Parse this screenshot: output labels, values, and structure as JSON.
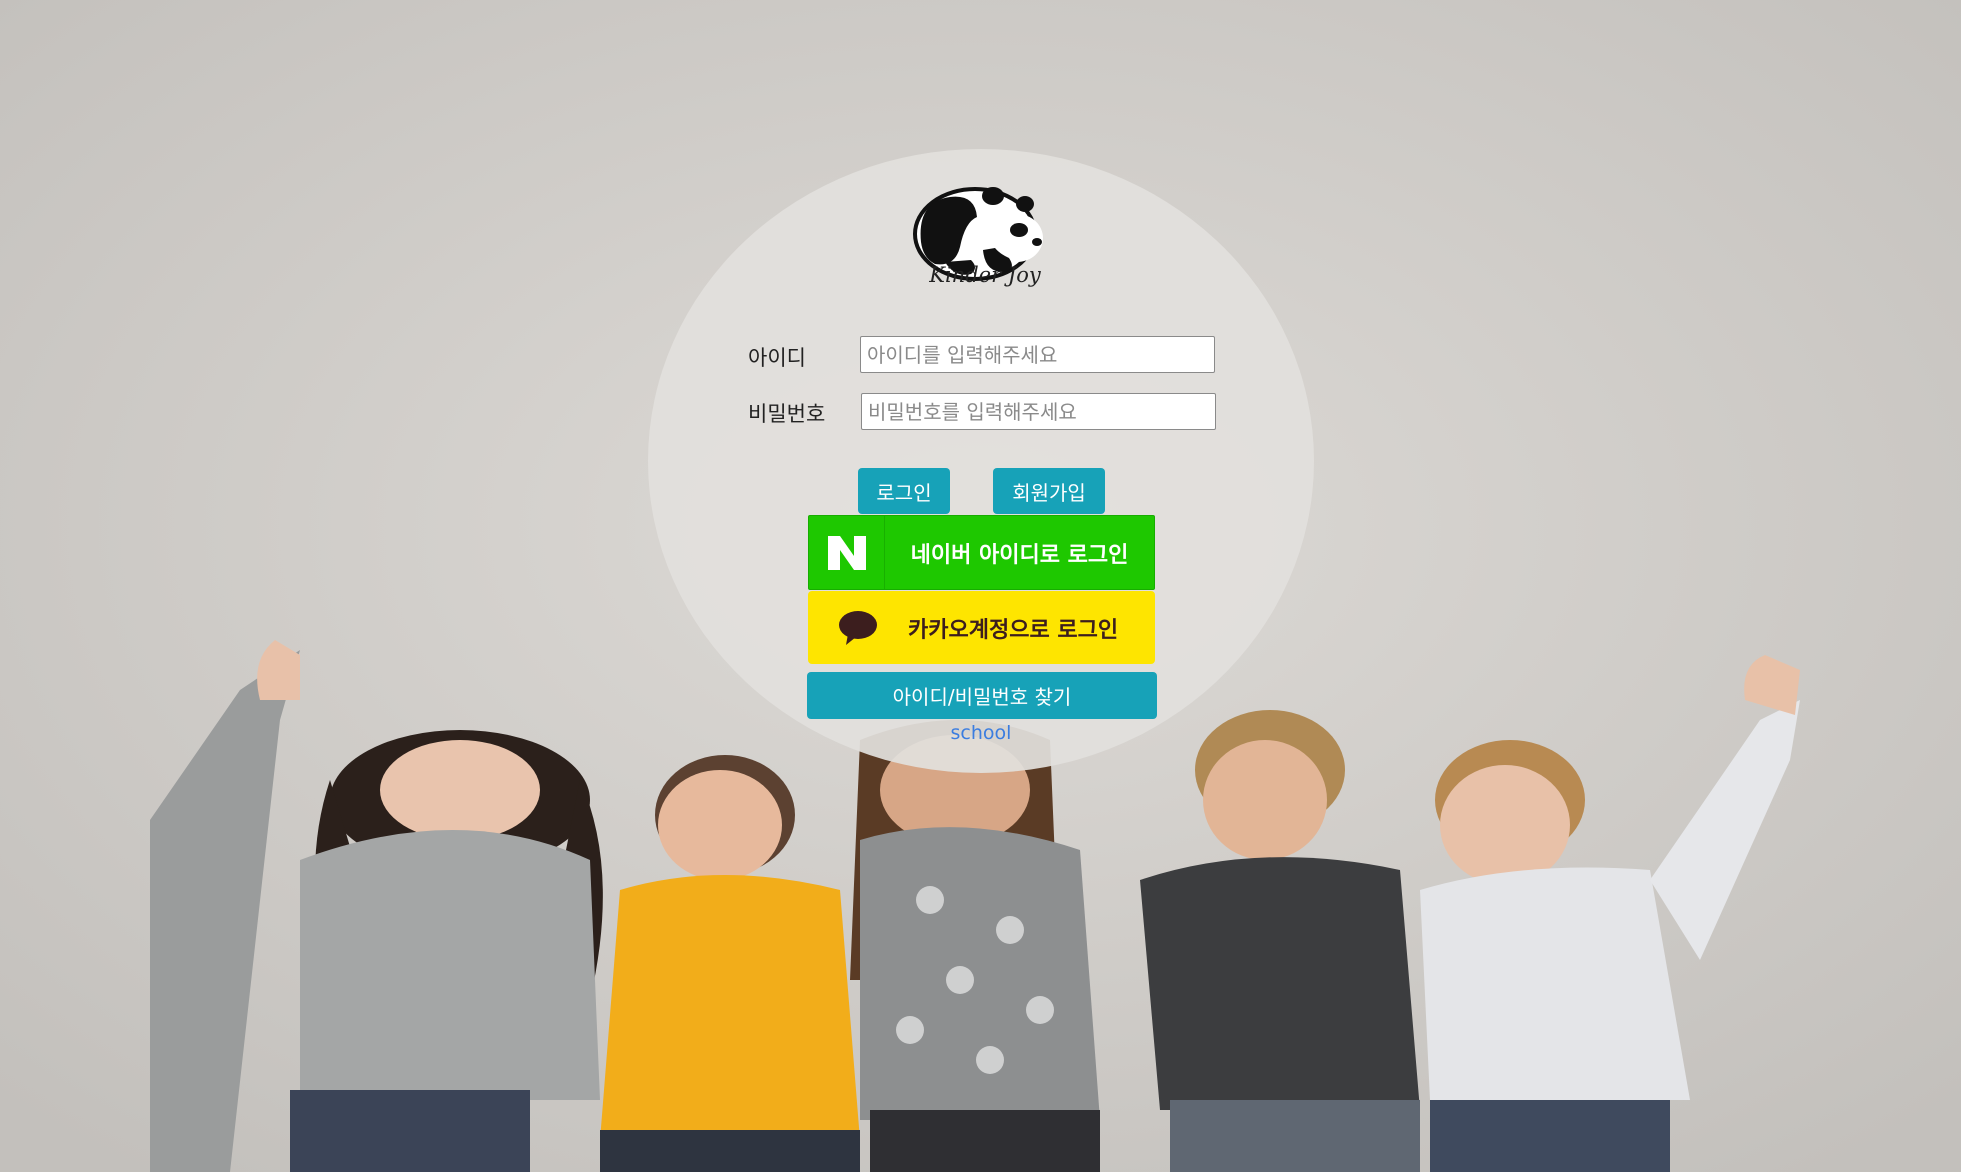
{
  "logo": {
    "icon": "panda-icon",
    "text": "Kinder Joy"
  },
  "form": {
    "id_label": "아이디",
    "id_placeholder": "아이디를 입력해주세요",
    "id_value": "",
    "pw_label": "비밀번호",
    "pw_placeholder": "비밀번호를 입력해주세요",
    "pw_value": ""
  },
  "buttons": {
    "login": "로그인",
    "signup": "회원가입",
    "naver_login": "네이버 아이디로 로그인",
    "kakao_login": "카카오계정으로 로그인",
    "find_account": "아이디/비밀번호 찾기"
  },
  "links": {
    "school": "school"
  },
  "colors": {
    "teal_button": "#17a2b8",
    "naver_green": "#1ec800",
    "kakao_yellow": "#fee500",
    "link_blue": "#3b7de0"
  }
}
